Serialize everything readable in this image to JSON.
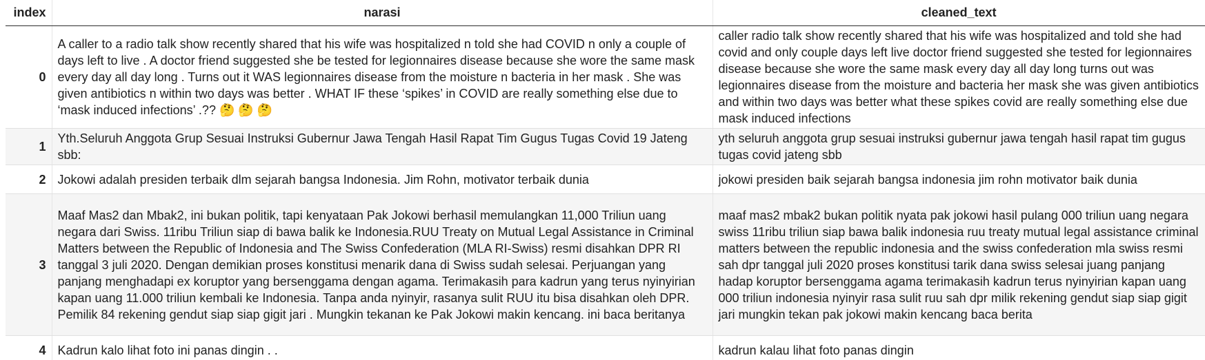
{
  "table": {
    "columns": [
      "index",
      "narasi",
      "cleaned_text"
    ],
    "rows": [
      {
        "index": "0",
        "narasi": "A caller to a radio talk show recently shared that his wife was hospitalized n told she had COVID n only a couple of days left to live . A doctor friend suggested she be tested for legionnaires disease because she wore the same mask every day all day long . Turns out it WAS legionnaires disease from the moisture n bacteria in her mask . She was given antibiotics n within two days was better . WHAT IF these ‘spikes’ in COVID are really something else due to ‘mask induced infections’ .?? 🤔 🤔 🤔",
        "cleaned_text": "caller radio talk show recently shared that his wife was hospitalized and told she had covid and only couple days left live doctor friend suggested she tested for legionnaires disease because she wore the same mask every day all day long turns out was legionnaires disease from the moisture and bacteria her mask she was given antibiotics and within two days was better what these spikes covid are really something else due mask induced infections"
      },
      {
        "index": "1",
        "narasi": "Yth.Seluruh Anggota Grup Sesuai Instruksi Gubernur Jawa Tengah Hasil Rapat Tim Gugus Tugas Covid 19 Jateng sbb:",
        "cleaned_text": "yth seluruh anggota grup sesuai instruksi gubernur jawa tengah hasil rapat tim gugus tugas covid jateng sbb"
      },
      {
        "index": "2",
        "narasi": "Jokowi adalah presiden terbaik dlm sejarah bangsa Indonesia. Jim Rohn, motivator terbaik dunia",
        "cleaned_text": "jokowi presiden baik sejarah bangsa indonesia jim rohn motivator baik dunia"
      },
      {
        "index": "3",
        "narasi": "Maaf Mas2 dan Mbak2, ini bukan politik, tapi kenyataan Pak Jokowi berhasil memulangkan 11,000 Triliun uang negara dari Swiss. 11ribu Triliun siap di bawa balik ke Indonesia.RUU Treaty on Mutual Legal Assistance in Criminal Matters between the Republic of Indonesia and The Swiss Confederation (MLA RI-Swiss) resmi disahkan DPR RI tanggal 3 juli 2020. Dengan demikian proses konstitusi menarik dana di Swiss sudah selesai. Perjuangan yang panjang menghadapi ex koruptor yang bersenggama dengan agama. Terimakasih para kadrun yang terus nyinyirian kapan uang 11.000 triliun kembali ke Indonesia. Tanpa anda nyinyir, rasanya sulit RUU itu bisa disahkan oleh DPR. Pemilik 84 rekening gendut siap siap gigit jari . Mungkin tekanan ke Pak Jokowi makin kencang. ini baca beritanya",
        "cleaned_text": "maaf mas2 mbak2 bukan politik nyata pak jokowi hasil pulang 000 triliun uang negara swiss 11ribu triliun siap bawa balik indonesia ruu treaty mutual legal assistance criminal matters between the republic indonesia and the swiss confederation mla swiss resmi sah dpr tanggal juli 2020 proses konstitusi tarik dana swiss selesai juang panjang hadap koruptor bersenggama agama terimakasih kadrun terus nyinyirian kapan uang 000 triliun indonesia nyinyir rasa sulit ruu sah dpr milik rekening gendut siap siap gigit jari mungkin tekan pak jokowi makin kencang baca berita"
      },
      {
        "index": "4",
        "narasi": "Kadrun kalo lihat foto ini panas dingin . .",
        "cleaned_text": "kadrun kalau lihat foto panas dingin"
      }
    ]
  }
}
